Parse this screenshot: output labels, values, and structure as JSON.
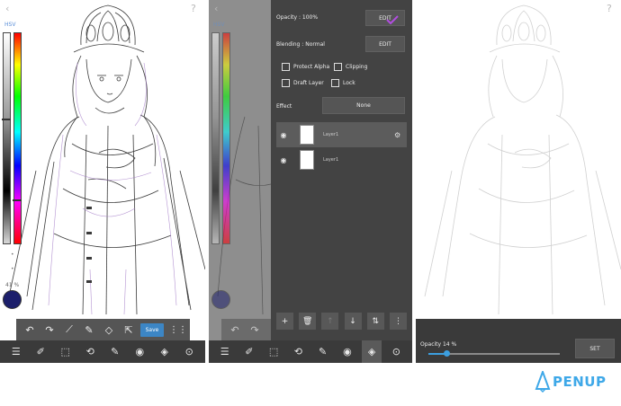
{
  "colors": {
    "toolbar_bg": "#3a3a3a",
    "panel_bg": "#434343",
    "accent_blue": "#3c86c5",
    "brand": "#3ea8e8",
    "sketch_purple": "#a178c6"
  },
  "panel1": {
    "color_mode": "HSV",
    "zoom": "41 %",
    "save_label": "Save",
    "tool_popup_icons": [
      "undo-icon",
      "redo-icon",
      "eyedropper-icon",
      "pen-icon",
      "eraser-icon",
      "export-icon"
    ],
    "toolbar_icons": [
      "menu-icon",
      "edit-icon",
      "select-icon",
      "rotate-icon",
      "brush-icon",
      "palette-icon",
      "layers-icon",
      "more-icon"
    ]
  },
  "panel2": {
    "opacity_label": "Opacity : 100%",
    "edit_label": "EDIT",
    "blending_label": "Blending : Normal",
    "edit2_label": "EDIT",
    "protect_alpha": "Protect Alpha",
    "clipping": "Clipping",
    "draft_layer": "Draft Layer",
    "lock": "Lock",
    "effect_label": "Effect",
    "effect_value": "None",
    "layers": [
      {
        "name": "Layer1",
        "selected": true
      },
      {
        "name": "Layer1",
        "selected": false
      }
    ]
  },
  "panel3": {
    "opacity_label": "Opacity 14 %",
    "opacity_value": 14,
    "set_label": "SET"
  },
  "brand": {
    "name": "PENUP"
  }
}
